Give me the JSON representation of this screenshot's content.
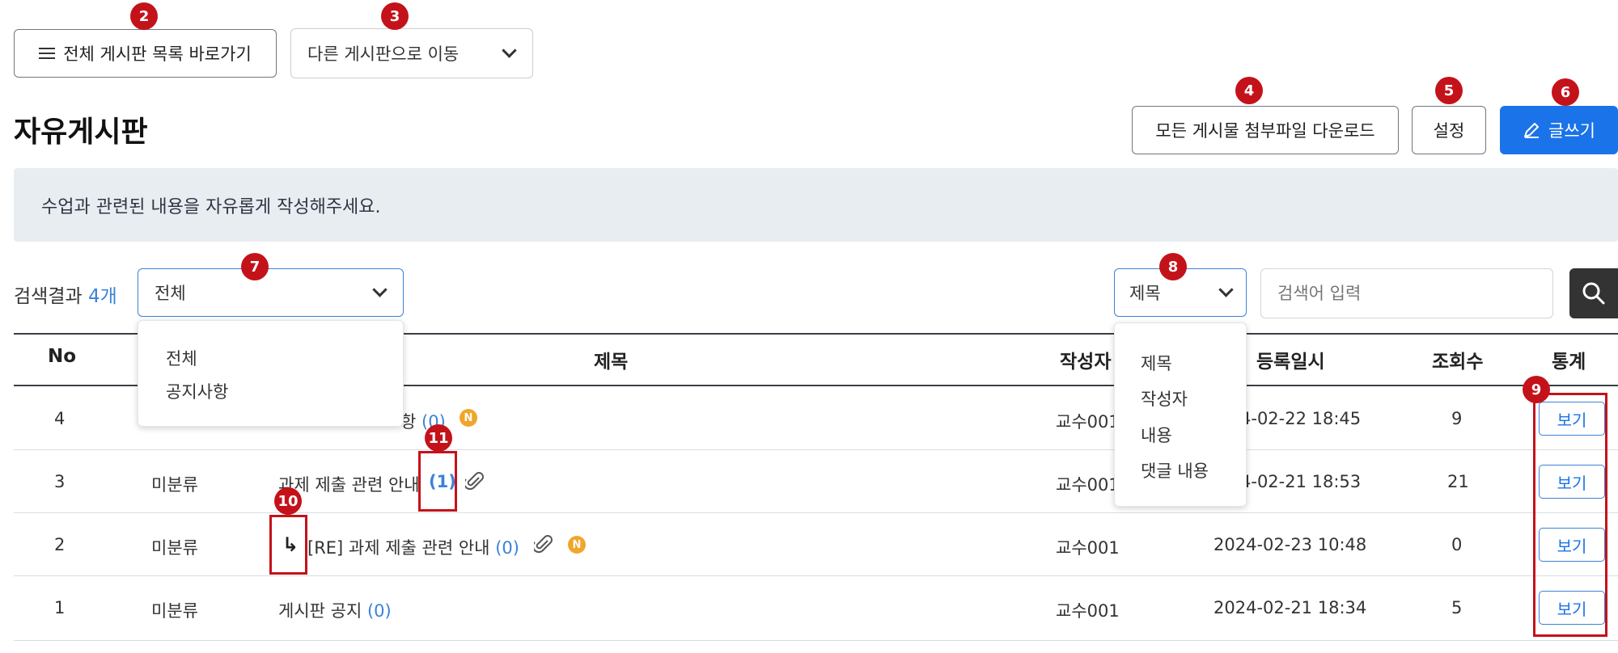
{
  "top": {
    "board_list_button": "전체 게시판 목록 바로가기",
    "move_board_select": "다른 게시판으로 이동"
  },
  "header": {
    "title": "자유게시판",
    "download_all_button": "모든 게시물 첨부파일 다운로드",
    "settings_button": "설정",
    "write_button": "글쓰기"
  },
  "notice": "수업과 관련된 내용을 자유롭게 작성해주세요.",
  "search": {
    "result_prefix": "검색결과",
    "result_count": "4개",
    "category_value": "전체",
    "category_options": [
      "전체",
      "공지사항"
    ],
    "field_value": "제목",
    "field_options": [
      "제목",
      "작성자",
      "내용",
      "댓글 내용"
    ],
    "placeholder": "검색어 입력"
  },
  "table": {
    "headers": {
      "no": "No",
      "title": "제목",
      "author": "작성자",
      "date": "등록일시",
      "views": "조회수",
      "stats": "통계"
    },
    "rows": [
      {
        "no": "4",
        "category": "",
        "title": "항",
        "comments": "(0)",
        "author": "교수001",
        "date": "4-02-22 18:45",
        "views": "9",
        "stats": "보기"
      },
      {
        "no": "3",
        "category": "미분류",
        "title": "과제 제출 관련 안내",
        "comments": "(1)",
        "author": "교수001",
        "date": "4-02-21 18:53",
        "views": "21",
        "stats": "보기"
      },
      {
        "no": "2",
        "category": "미분류",
        "title": "[RE] 과제 제출 관련 안내",
        "comments": "(0)",
        "author": "교수001",
        "date": "2024-02-23 10:48",
        "views": "0",
        "stats": "보기"
      },
      {
        "no": "1",
        "category": "미분류",
        "title": "게시판 공지",
        "comments": "(0)",
        "author": "교수001",
        "date": "2024-02-21 18:34",
        "views": "5",
        "stats": "보기"
      }
    ]
  },
  "markers": [
    "2",
    "3",
    "4",
    "5",
    "6",
    "7",
    "8",
    "9",
    "10",
    "11"
  ],
  "icons": {
    "new_badge_letter": "N",
    "reply_arrow": "↳"
  },
  "colors": {
    "primary": "#1a73e8",
    "marker": "#c4121a",
    "new_badge": "#f0a62a",
    "notice_bg": "#e8edf2"
  }
}
